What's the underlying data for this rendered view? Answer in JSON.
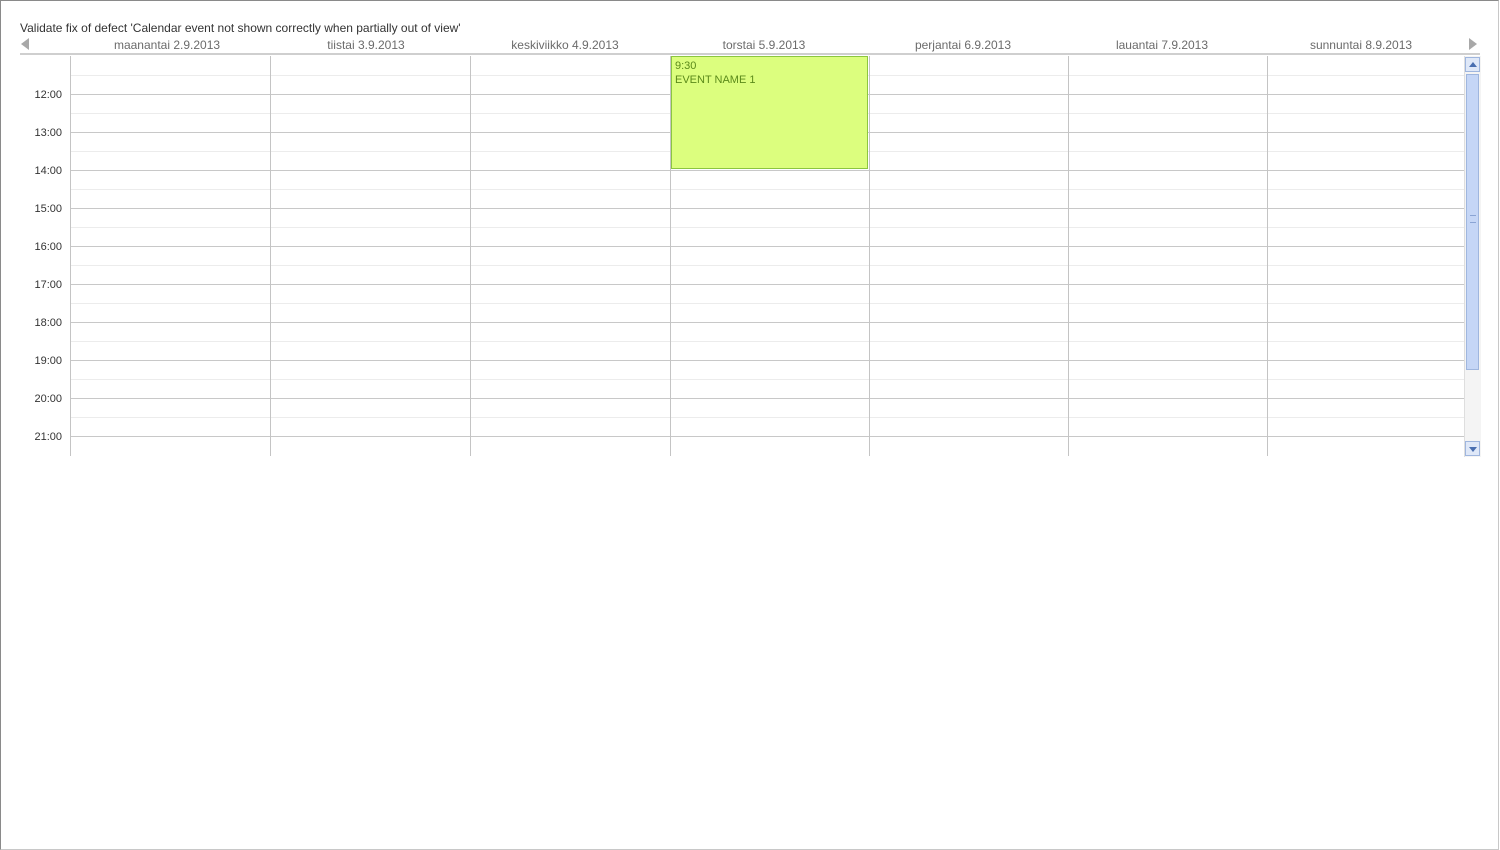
{
  "caption": "Validate fix of defect 'Calendar event not shown correctly when partially out of view'",
  "days": [
    {
      "label": "maanantai 2.9.2013"
    },
    {
      "label": "tiistai 3.9.2013"
    },
    {
      "label": "keskiviikko 4.9.2013"
    },
    {
      "label": "torstai 5.9.2013"
    },
    {
      "label": "perjantai 6.9.2013"
    },
    {
      "label": "lauantai 7.9.2013"
    },
    {
      "label": "sunnuntai 8.9.2013"
    }
  ],
  "hours": [
    "12:00",
    "13:00",
    "14:00",
    "15:00",
    "16:00",
    "17:00",
    "18:00",
    "19:00",
    "20:00",
    "21:00"
  ],
  "event": {
    "time": "9:30",
    "name": "EVENT NAME 1",
    "day": "torstai 5.9.2013",
    "background": "#dcfe7e",
    "border": "#8cc63f"
  },
  "icons": {
    "prev": "arrow-left-icon",
    "next": "arrow-right-icon",
    "scroll_up": "chevron-up-icon",
    "scroll_down": "chevron-down-icon"
  }
}
